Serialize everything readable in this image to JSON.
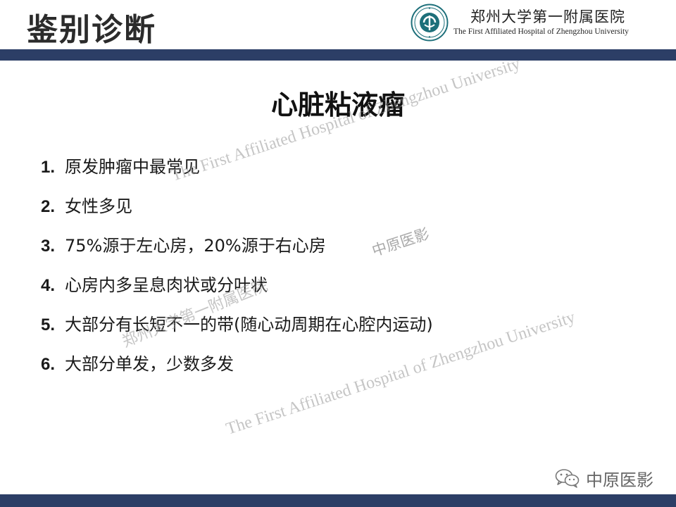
{
  "header": {
    "title": "鉴别诊断",
    "hospital_cn": "郑州大学第一附属医院",
    "hospital_en": "The First Affiliated Hospital of Zhengzhou University",
    "logo_icon": "hospital-seal-logo",
    "bar_color": "#2c3e66"
  },
  "main": {
    "heading": "心脏粘液瘤",
    "points": [
      {
        "num": "1.",
        "text": "原发肿瘤中最常见"
      },
      {
        "num": "2.",
        "text": "女性多见"
      },
      {
        "num": "3.",
        "text": "75%源于左心房，20%源于右心房"
      },
      {
        "num": "4.",
        "text": "心房内多呈息肉状或分叶状"
      },
      {
        "num": "5.",
        "text": "大部分有长短不一的带(随心动周期在心腔内运动)"
      },
      {
        "num": "6.",
        "text": "大部分单发，少数多发"
      }
    ]
  },
  "watermarks": {
    "en_1": "The First Affiliated Hospital of Zhengzhou University",
    "en_2": "The First Affiliated Hospital of Zhengzhou University",
    "cn_1": "郑州大学第一附属医院",
    "cn_2": "中原医影"
  },
  "footer": {
    "wechat_label": "中原医影",
    "wechat_icon": "wechat-icon"
  }
}
